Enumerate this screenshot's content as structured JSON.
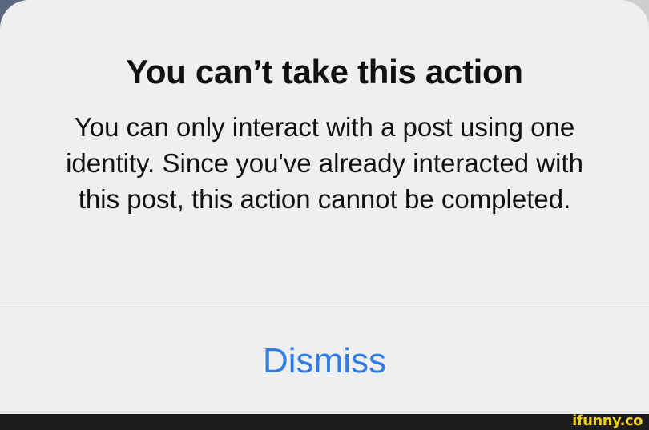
{
  "alert": {
    "title": "You can’t take this action",
    "message": "You can only interact with a post using one identity. Since you've already interacted with this post, this action cannot be completed.",
    "dismiss_label": "Dismiss"
  },
  "watermark": {
    "text": "ifunny.co"
  },
  "colors": {
    "accent": "#2f7ee6",
    "watermark": "#f2d21a"
  }
}
